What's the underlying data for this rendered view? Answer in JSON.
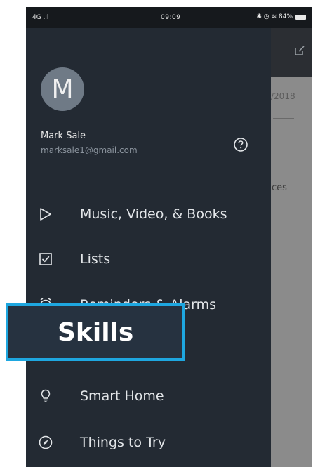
{
  "status_bar": {
    "signal": "4G .ıl",
    "time": "09:09",
    "indicators": "✱ ◷ ≋ 84%"
  },
  "background": {
    "date_fragment": "/2018",
    "word_fragment": "ces",
    "edit_icon": "edit-icon"
  },
  "drawer": {
    "avatar_letter": "M",
    "user_name": "Mark Sale",
    "user_email": "marksale1@gmail.com",
    "help_icon": "help-circle-icon",
    "menu": [
      {
        "label": "Music, Video, & Books",
        "icon": "play-icon"
      },
      {
        "label": "Lists",
        "icon": "checkbox-icon"
      },
      {
        "label": "Reminders & Alarms",
        "icon": "alarm-icon"
      },
      {
        "label": "Smart Home",
        "icon": "lightbulb-icon"
      },
      {
        "label": "Things to Try",
        "icon": "compass-icon"
      }
    ]
  },
  "callout": {
    "label": "Skills",
    "border_color": "#1ea7e0"
  }
}
